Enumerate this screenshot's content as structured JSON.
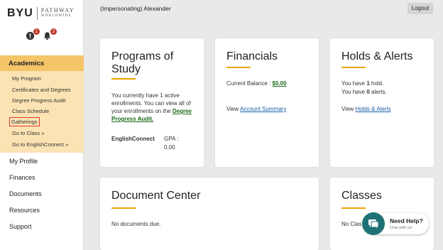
{
  "header": {
    "user": "(Impersonating) Alexander",
    "logout_label": "Logout"
  },
  "logo": {
    "brand": "BYU",
    "line1": "PATHWAY",
    "line2": "WORLDWIDE"
  },
  "notifications": {
    "alerts_count": "1",
    "bell_count": "2"
  },
  "sidebar": {
    "academics_label": "Academics",
    "academics_items": [
      "My Program",
      "Certificates and Degrees",
      "Degree Progress Audit",
      "Class Schedule",
      "Gatherings",
      "Go to Class »",
      "Go to EnglishConnect »"
    ],
    "nav_items": [
      "My Profile",
      "Finances",
      "Documents",
      "Resources",
      "Support"
    ]
  },
  "programs": {
    "title": "Programs of Study",
    "text": "You currently have 1 active enrollments. You can view all of your enrollments on the",
    "link": "Degree Progress Audit.",
    "program_name": "EnglishConnect",
    "gpa_label": "GPA :",
    "gpa_value": "0.00"
  },
  "financials": {
    "title": "Financials",
    "balance_label": "Current Balance :",
    "balance_value": "$0.00",
    "view_label": "View",
    "view_link": "Account Summary"
  },
  "holds": {
    "title": "Holds & Alerts",
    "holds_pre": "You have",
    "holds_count": "1",
    "holds_post": "hold.",
    "alerts_pre": "You have",
    "alerts_count": "0",
    "alerts_post": "alerts.",
    "view_label": "View",
    "view_link": "Holds & Alerts"
  },
  "documents": {
    "title": "Document Center",
    "text": "No documents due."
  },
  "classes": {
    "title": "Classes",
    "text": "No Clas"
  },
  "chat": {
    "title": "Need Help?",
    "subtitle": "Chat with us!"
  },
  "colors": {
    "accent": "#f0a500",
    "academics_bg": "#f5c469",
    "academics_sub_bg": "#fbe3b3",
    "chat": "#1e7275"
  }
}
